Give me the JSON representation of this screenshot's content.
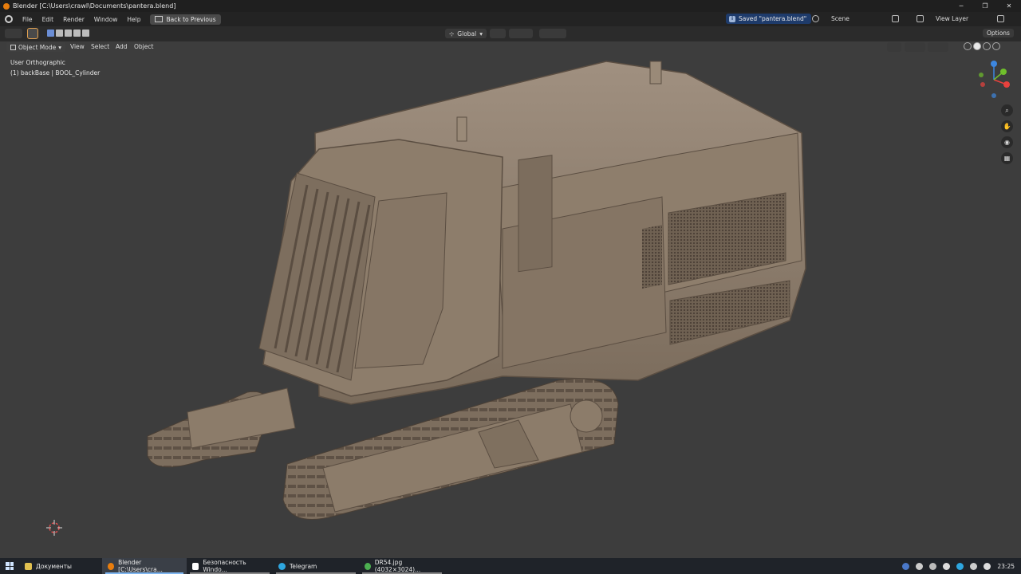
{
  "window": {
    "title": "Blender [C:\\Users\\crawl\\Documents\\pantera.blend]"
  },
  "menubar": {
    "items": [
      "File",
      "Edit",
      "Render",
      "Window",
      "Help"
    ],
    "back_button": "Back to Previous",
    "saved_notice": "Saved \"pantera.blend\"",
    "scene": "Scene",
    "view_layer": "View Layer"
  },
  "toolbar": {
    "orientation": "Global",
    "options": "Options"
  },
  "viewport_header": {
    "mode": "Object Mode",
    "menus": [
      "View",
      "Select",
      "Add",
      "Object"
    ]
  },
  "viewport_overlay": {
    "view_name": "User Orthographic",
    "active_object": "(1) backBase | BOOL_Cylinder"
  },
  "gizmo": {
    "axes": [
      "X",
      "Y",
      "Z"
    ],
    "colors": {
      "x": "#e8413d",
      "y": "#6fbf2b",
      "z": "#3d87e0"
    }
  },
  "navigation": [
    "zoom-icon",
    "hand-icon",
    "camera-icon",
    "grid-icon"
  ],
  "taskbar": {
    "items": [
      {
        "label": "Документы",
        "icon_color": "#e0c050",
        "active": false
      },
      {
        "label": "Blender [C:\\Users\\cra...",
        "icon_color": "#e87d0d",
        "active": true
      },
      {
        "label": "Безопасность Windo...",
        "icon_color": "#ffffff",
        "active": false
      },
      {
        "label": "Telegram",
        "icon_color": "#2ea6df",
        "active": false
      },
      {
        "label": "DR54.jpg (4032×3024)...",
        "icon_color": "#4caf50",
        "active": false
      }
    ],
    "clock": "23:25"
  },
  "colors": {
    "viewport_bg": "#3d3d3d",
    "model": "#8a7a68",
    "accent": "#e87d0d",
    "selection": "#6b8ed6"
  }
}
